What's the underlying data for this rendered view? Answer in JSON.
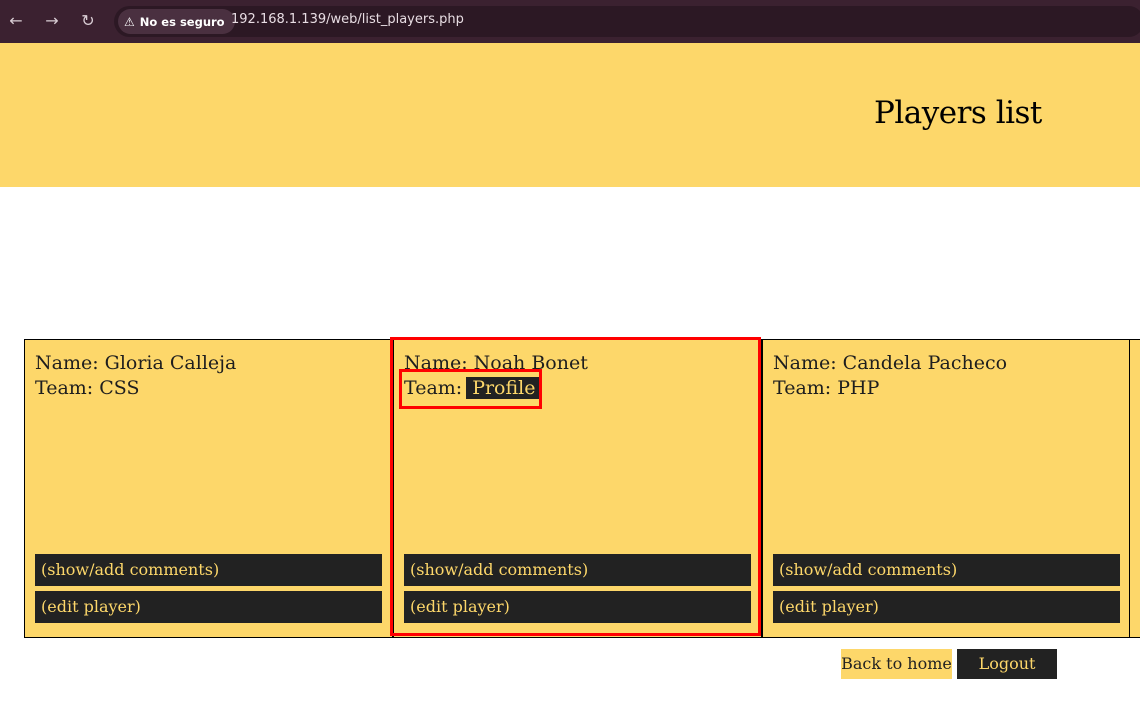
{
  "browser": {
    "security_label": "No es seguro",
    "url": "192.168.1.139/web/list_players.php"
  },
  "header": {
    "title": "Players list"
  },
  "players": [
    {
      "name": "Name: Gloria Calleja",
      "team_label": "Team: CSS",
      "comments_label": "(show/add comments)",
      "edit_label": "(edit player)"
    },
    {
      "name": "Name: Noah Bonet",
      "team_label": "Team:",
      "team_value": "Profile",
      "comments_label": "(show/add comments)",
      "edit_label": "(edit player)"
    },
    {
      "name": "Name: Candela Pacheco",
      "team_label": "Team: PHP",
      "comments_label": "(show/add comments)",
      "edit_label": "(edit player)"
    }
  ],
  "footer_nav": {
    "back_label": "Back to home",
    "logout_label": "Logout"
  },
  "colors": {
    "accent": "#fdd76a",
    "dark": "#222222",
    "chrome": "#3b2130",
    "highlight": "#ff0000"
  }
}
